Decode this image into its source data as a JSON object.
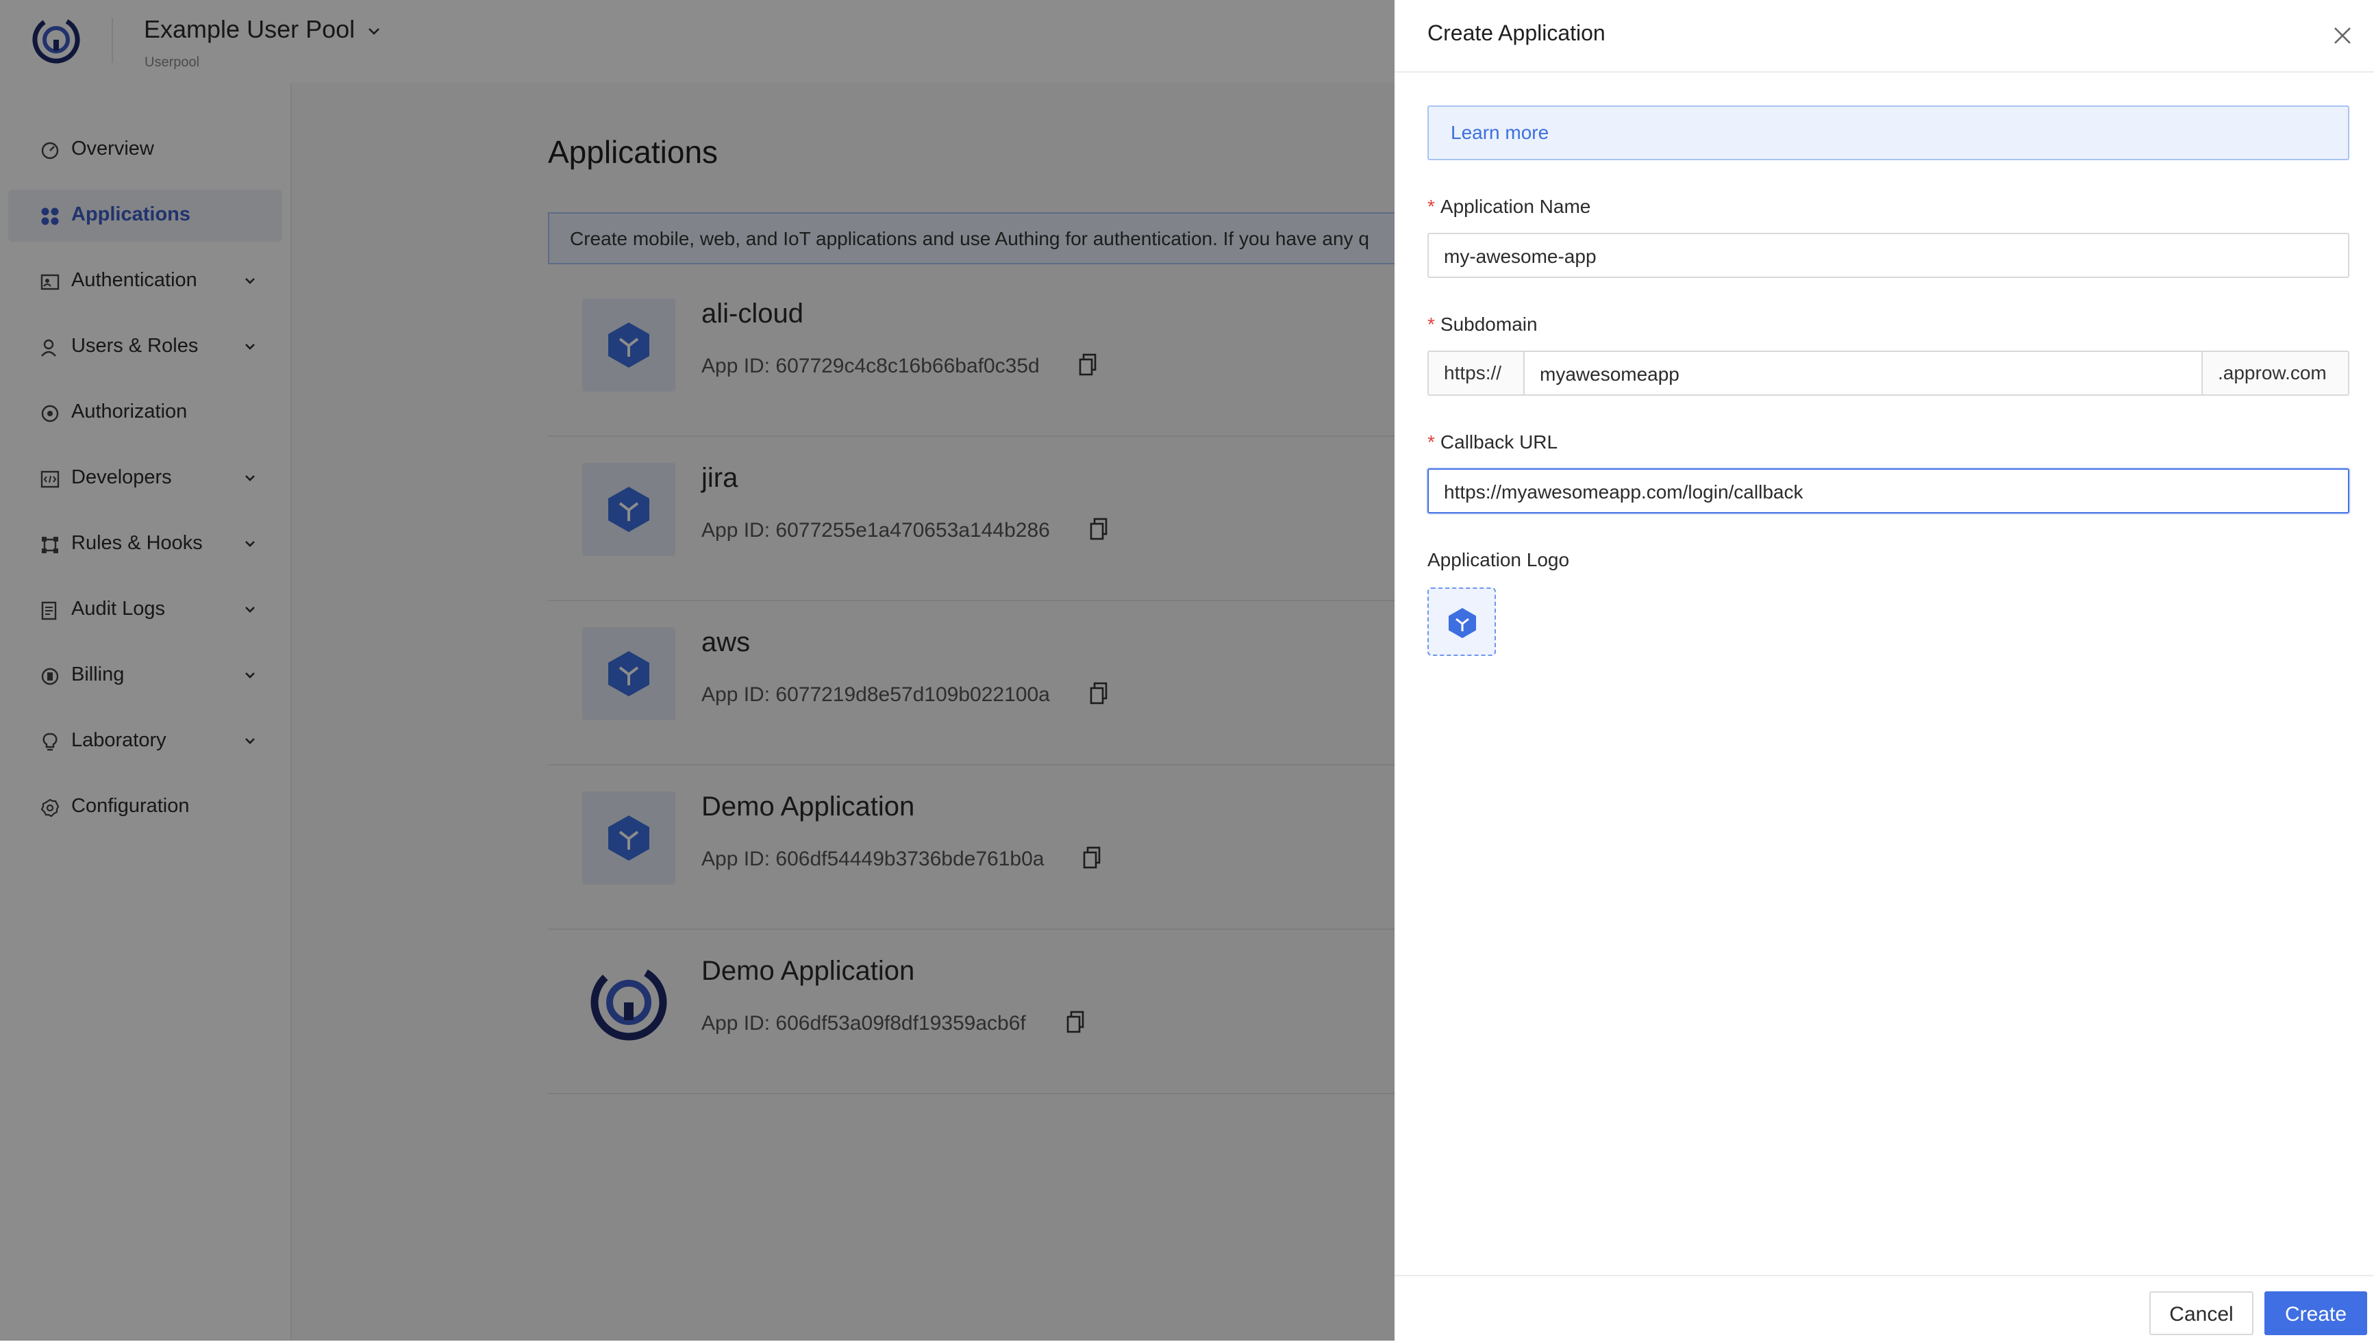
{
  "header": {
    "pool_name": "Example User Pool",
    "pool_subtitle": "Userpool"
  },
  "sidebar": {
    "items": [
      {
        "label": "Overview",
        "icon": "dashboard-icon",
        "expandable": false,
        "active": false
      },
      {
        "label": "Applications",
        "icon": "grid-apps-icon",
        "expandable": false,
        "active": true
      },
      {
        "label": "Authentication",
        "icon": "id-card-icon",
        "expandable": true,
        "active": false
      },
      {
        "label": "Users & Roles",
        "icon": "user-icon",
        "expandable": true,
        "active": false
      },
      {
        "label": "Authorization",
        "icon": "shield-icon",
        "expandable": false,
        "active": false
      },
      {
        "label": "Developers",
        "icon": "code-icon",
        "expandable": true,
        "active": false
      },
      {
        "label": "Rules & Hooks",
        "icon": "hooks-icon",
        "expandable": true,
        "active": false
      },
      {
        "label": "Audit Logs",
        "icon": "log-icon",
        "expandable": true,
        "active": false
      },
      {
        "label": "Billing",
        "icon": "billing-icon",
        "expandable": true,
        "active": false
      },
      {
        "label": "Laboratory",
        "icon": "bulb-icon",
        "expandable": true,
        "active": false
      },
      {
        "label": "Configuration",
        "icon": "gear-icon",
        "expandable": false,
        "active": false
      }
    ]
  },
  "main": {
    "title": "Applications",
    "info_text": "Create mobile, web, and IoT applications and use Authing for authentication. If you have any q",
    "apps": [
      {
        "name": "ali-cloud",
        "app_id": "App ID: 607729c4c8c16b66baf0c35d",
        "icon": "cube-icon"
      },
      {
        "name": "jira",
        "app_id": "App ID: 6077255e1a470653a144b286",
        "icon": "cube-icon"
      },
      {
        "name": "aws",
        "app_id": "App ID: 6077219d8e57d109b022100a",
        "icon": "cube-icon"
      },
      {
        "name": "Demo Application",
        "app_id": "App ID: 606df54449b3736bde761b0a",
        "icon": "cube-icon"
      },
      {
        "name": "Demo Application",
        "app_id": "App ID: 606df53a09f8df19359acb6f",
        "icon": "authing-logo-icon"
      }
    ]
  },
  "drawer": {
    "title": "Create Application",
    "learn_more": "Learn more",
    "app_name_label": "Application Name",
    "app_name_value": "my-awesome-app",
    "subdomain_label": "Subdomain",
    "subdomain_prefix": "https://",
    "subdomain_value": "myawesomeapp",
    "subdomain_suffix": ".approw.com",
    "callback_label": "Callback URL",
    "callback_value": "https://myawesomeapp.com/login/callback",
    "logo_label": "Application Logo",
    "cancel_label": "Cancel",
    "create_label": "Create"
  },
  "colors": {
    "accent": "#3f6fe3",
    "active_nav": "#3d5ec9",
    "required": "#e0423f",
    "brand_dark": "#1f2a6b"
  }
}
